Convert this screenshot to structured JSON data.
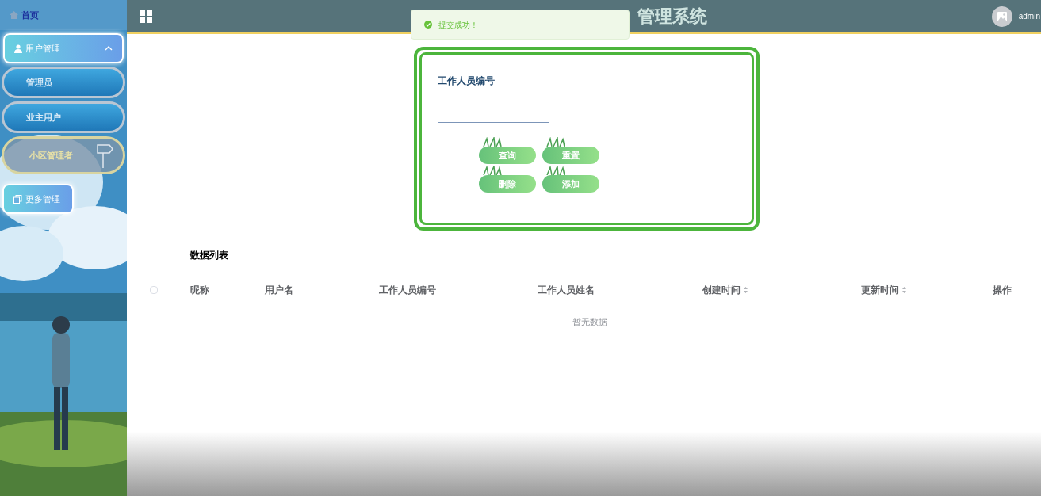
{
  "header": {
    "title": "管理系统",
    "user": "admin"
  },
  "toast": {
    "message": "提交成功！"
  },
  "sidebar": {
    "items": [
      {
        "kind": "home",
        "label": "首页"
      },
      {
        "kind": "group",
        "label": "用户管理",
        "expanded": true,
        "children": [
          {
            "kind": "pill",
            "label": "管理员",
            "selected": false
          },
          {
            "kind": "pill",
            "label": "业主用户",
            "selected": false
          },
          {
            "kind": "signpost",
            "label": "小区管理者",
            "selected": true
          }
        ]
      },
      {
        "kind": "single",
        "label": "更多管理"
      }
    ]
  },
  "search": {
    "label": "工作人员编号",
    "buttons": [
      "查询",
      "重置",
      "删除",
      "添加"
    ]
  },
  "table": {
    "title": "数据列表",
    "select_all": {
      "checked": false
    },
    "columns": [
      {
        "label": "昵称",
        "sortable": false
      },
      {
        "label": "用户名",
        "sortable": false
      },
      {
        "label": "工作人员编号",
        "sortable": false
      },
      {
        "label": "工作人员姓名",
        "sortable": false
      },
      {
        "label": "创建时间",
        "sortable": true
      },
      {
        "label": "更新时间",
        "sortable": true
      },
      {
        "label": "操作",
        "sortable": false
      }
    ],
    "empty_text": "暂无数据"
  }
}
